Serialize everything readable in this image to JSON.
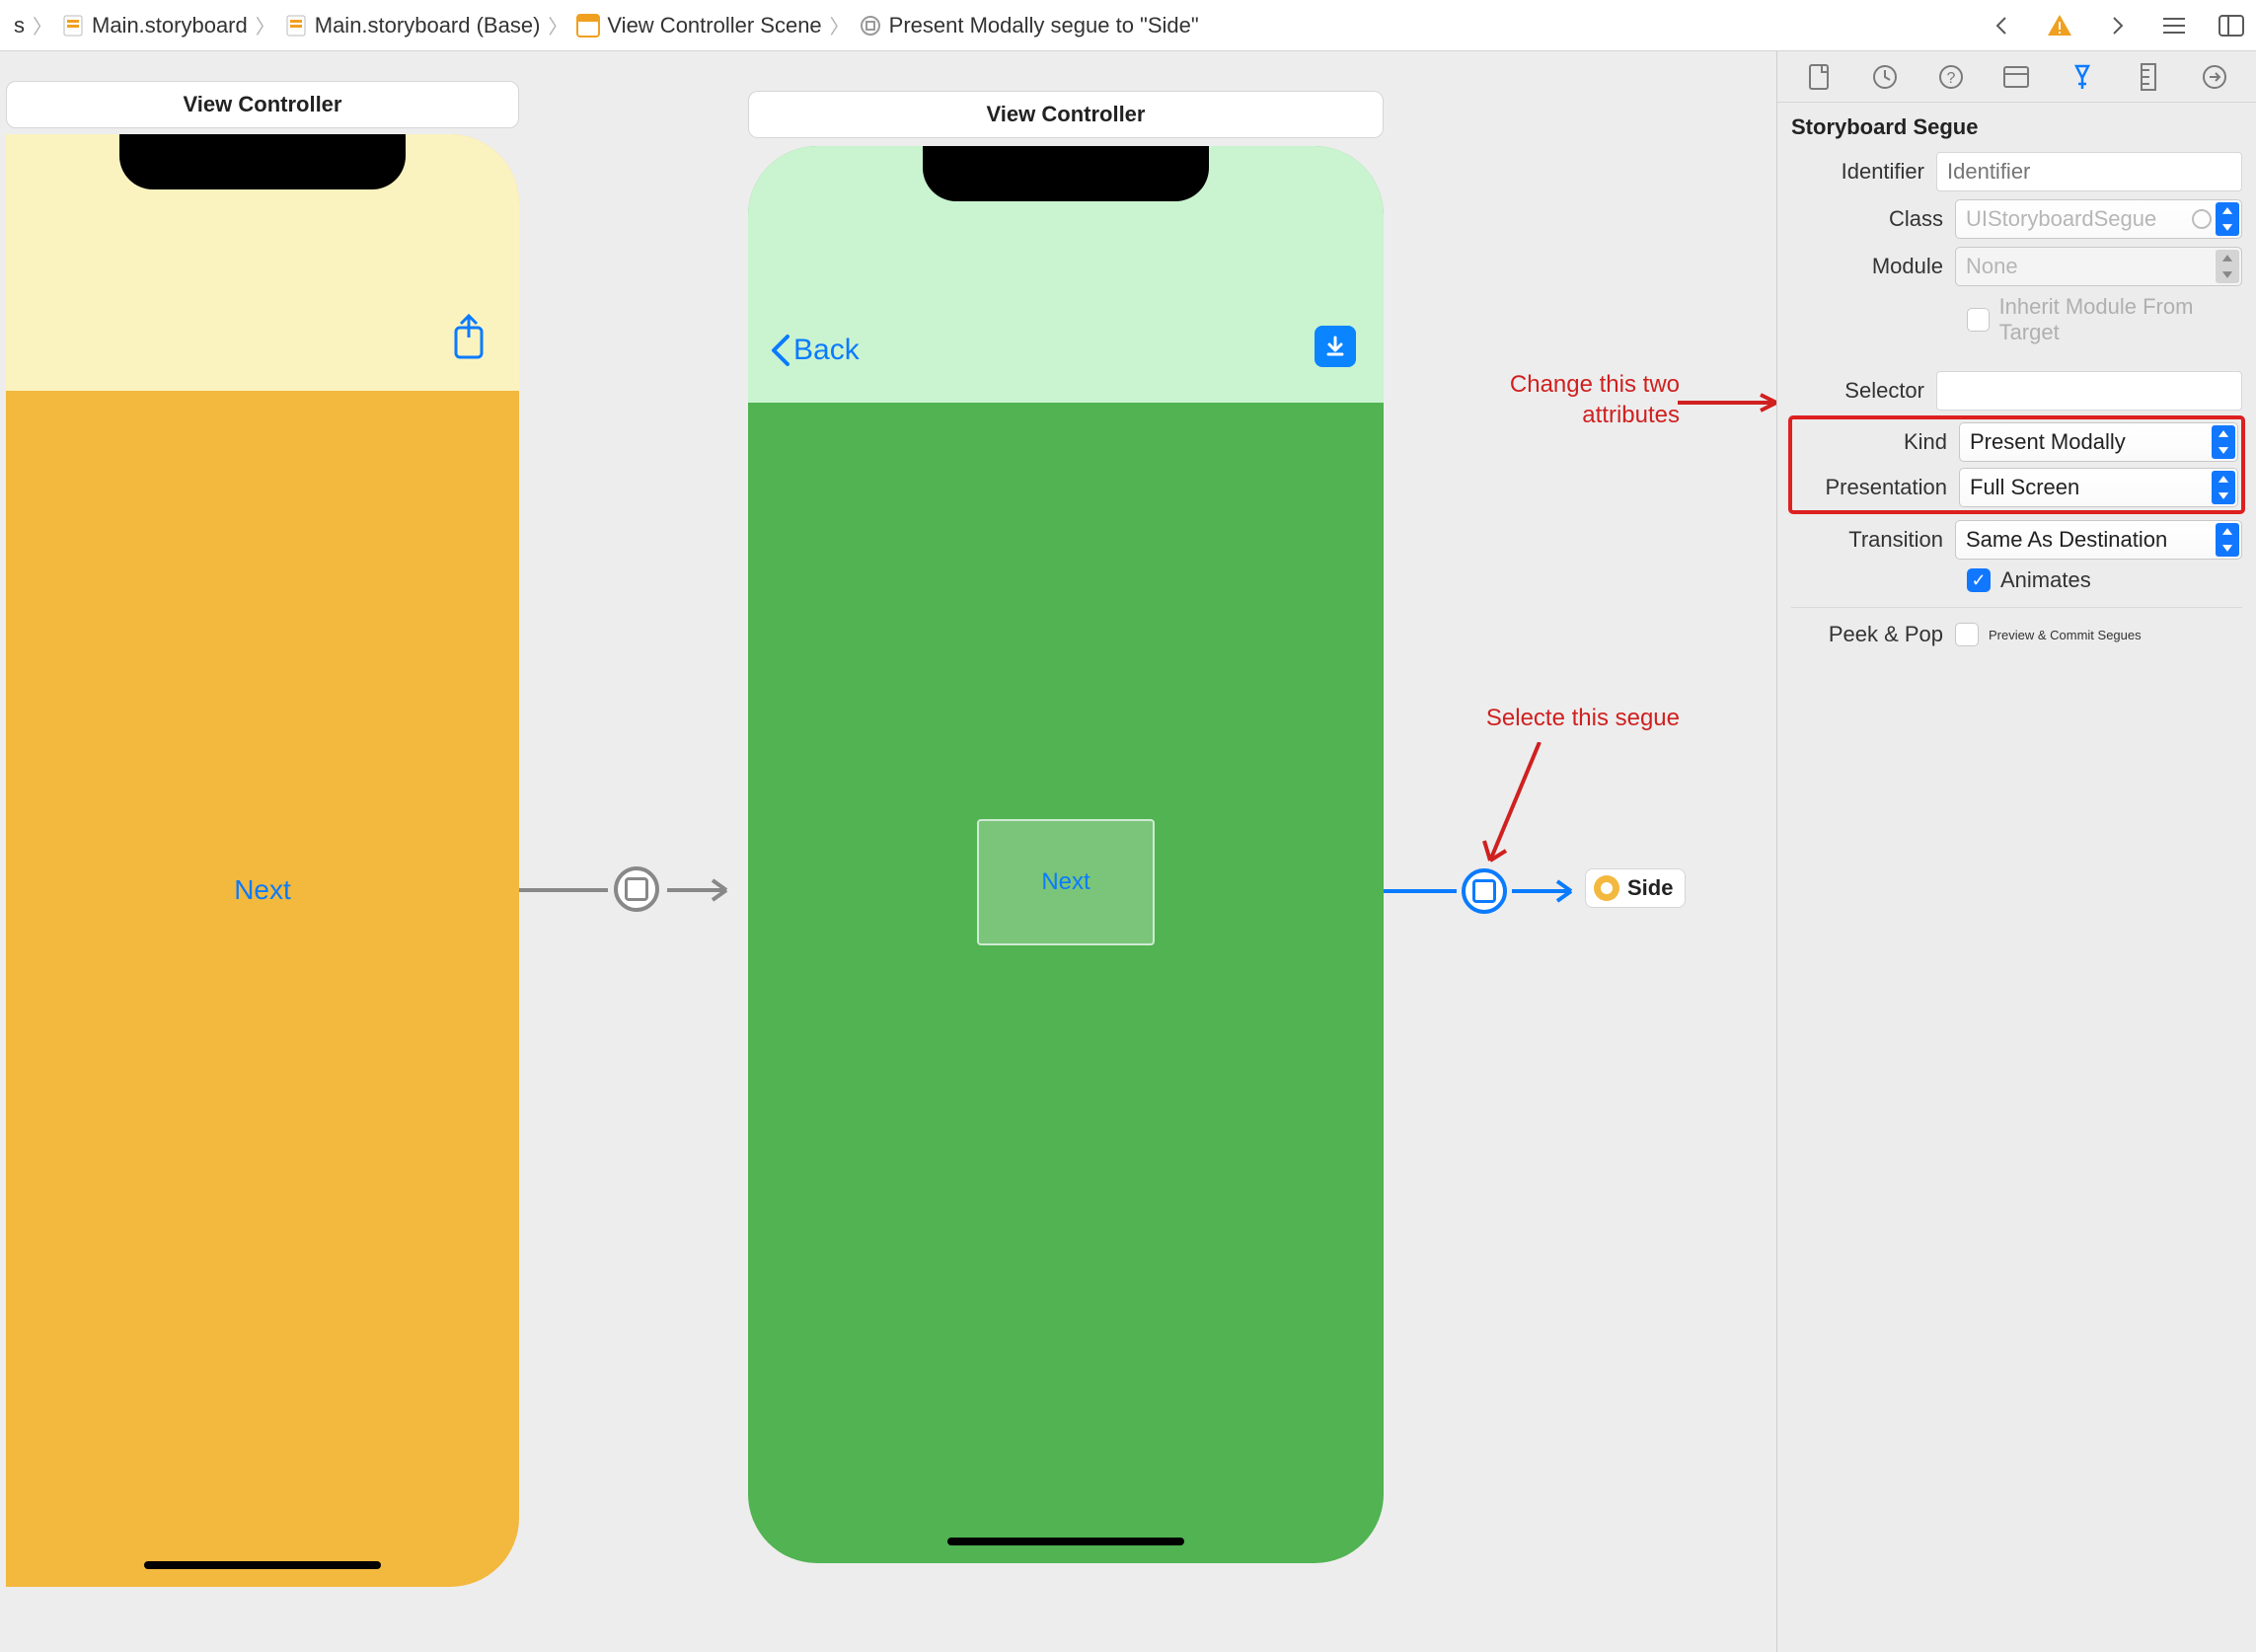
{
  "breadcrumbs": {
    "b0suffix": "s",
    "b1": "Main.storyboard",
    "b2": "Main.storyboard (Base)",
    "b3": "View Controller Scene",
    "b4": "Present Modally segue to \"Side\""
  },
  "scene": {
    "vc1_title": "View Controller",
    "vc2_title": "View Controller",
    "phone1": {
      "button_next": "Next"
    },
    "phone2": {
      "back_label": "Back",
      "button_next": "Next"
    },
    "side_chip": "Side"
  },
  "annotations": {
    "change_attrs": "Change this two\nattributes",
    "select_segue": "Selecte this segue"
  },
  "inspector": {
    "section_title": "Storyboard Segue",
    "rows": {
      "identifier_label": "Identifier",
      "identifier_placeholder": "Identifier",
      "class_label": "Class",
      "class_value": "UIStoryboardSegue",
      "module_label": "Module",
      "module_value": "None",
      "inherit_label": "Inherit Module From Target",
      "selector_label": "Selector",
      "kind_label": "Kind",
      "kind_value": "Present Modally",
      "presentation_label": "Presentation",
      "presentation_value": "Full Screen",
      "transition_label": "Transition",
      "transition_value": "Same As Destination",
      "animates_label": "Animates",
      "peek_label": "Peek & Pop",
      "peek_value": "Preview & Commit Segues"
    }
  }
}
